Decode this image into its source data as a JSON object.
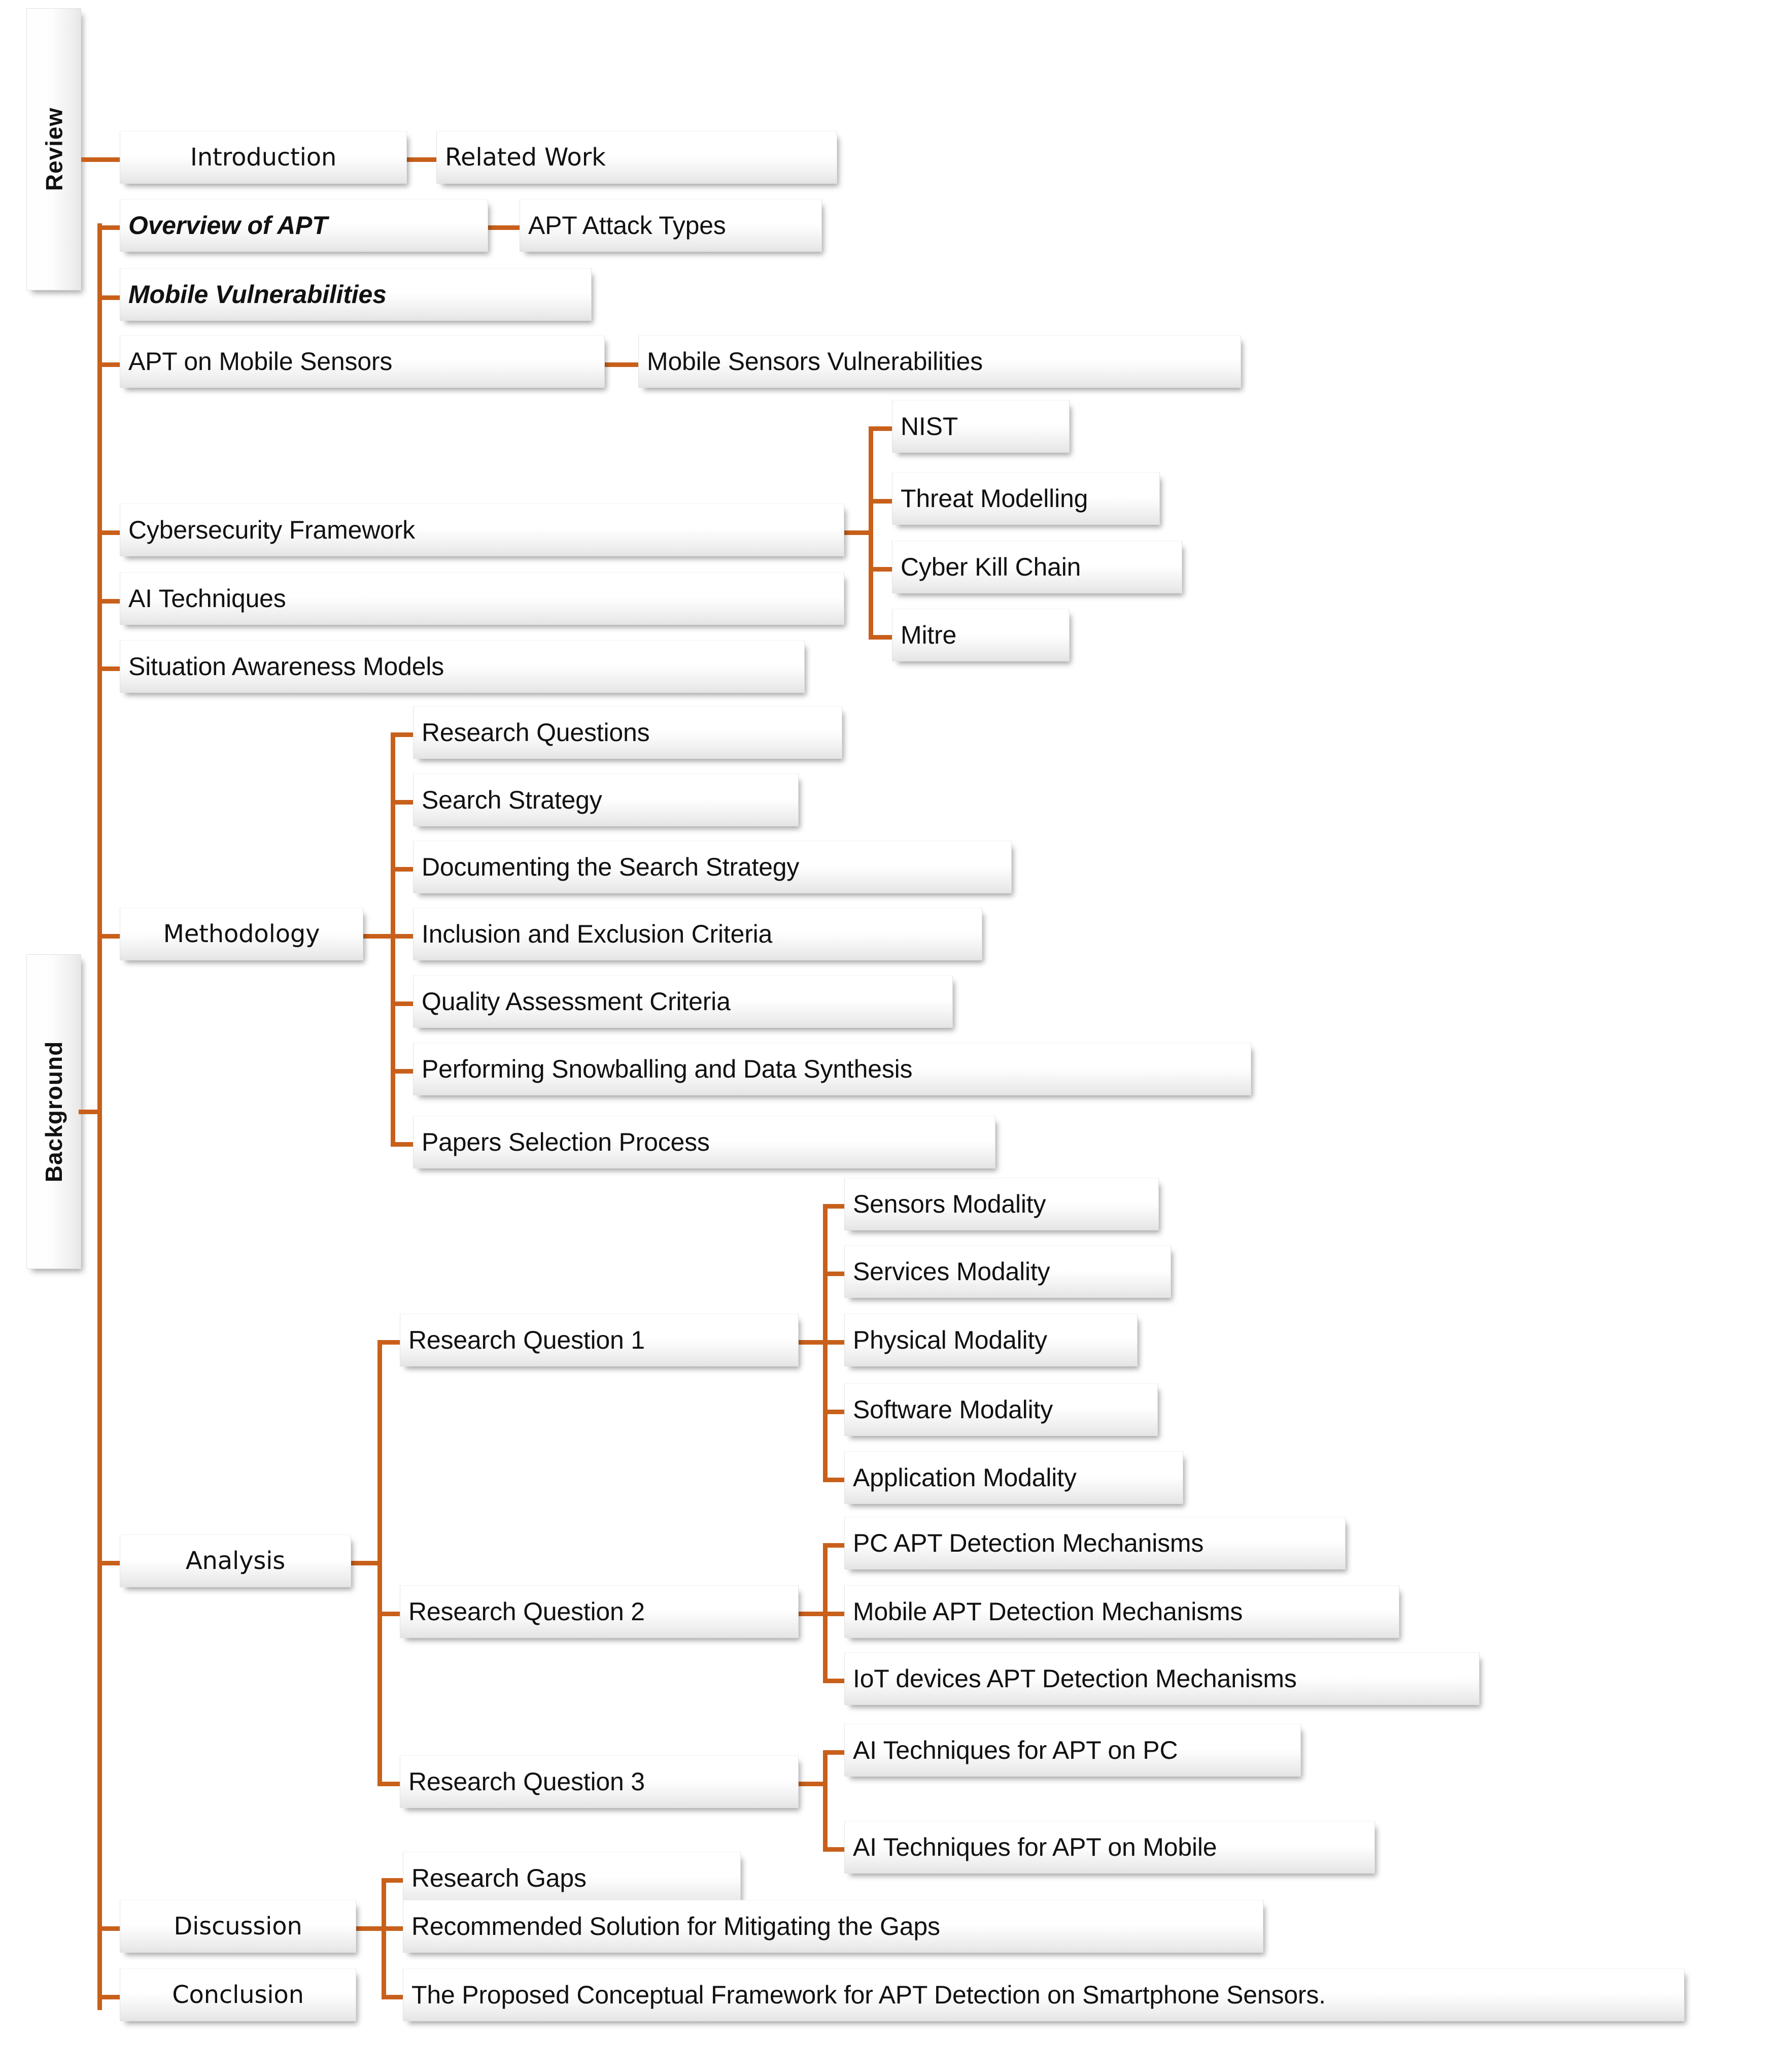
{
  "diagram": {
    "title": "APT Detection on Smartphone Sensors - Paper Structure",
    "accent_color": "#C8601B",
    "box_fill": "#f4f4f4",
    "text_color": "#111111"
  },
  "side_labels": {
    "review": "Review",
    "background": "Background"
  },
  "level1": {
    "introduction": "Introduction",
    "overview_of_apt": "Overview of APT",
    "mobile_vulnerabilities": "Mobile Vulnerabilities",
    "apt_on_mobile_sensors": "APT on Mobile Sensors",
    "cybersecurity_framework": "Cybersecurity Framework",
    "ai_techniques": "AI Techniques",
    "situation_awareness_models": "Situation Awareness Models",
    "methodology": "Methodology",
    "analysis": "Analysis",
    "discussion": "Discussion",
    "conclusion": "Conclusion"
  },
  "level2": {
    "related_work": "Related Work",
    "apt_attack_types": "APT Attack Types",
    "mobile_sensors_vulnerabilities": "Mobile Sensors Vulnerabilities",
    "framework_children": [
      "NIST",
      "Threat Modelling",
      "Cyber Kill Chain",
      "Mitre"
    ],
    "methodology_children": [
      "Research Questions",
      "Search Strategy",
      "Documenting the Search Strategy",
      "Inclusion and Exclusion Criteria",
      "Quality Assessment Criteria",
      "Performing Snowballing and Data Synthesis",
      "Papers Selection Process"
    ],
    "analysis_children": [
      "Research Question 1",
      "Research Question 2",
      "Research Question 3"
    ],
    "discussion_children": [
      "Research Gaps",
      "Recommended Solution for Mitigating the Gaps"
    ],
    "conclusion_children": [
      "The Proposed Conceptual Framework for APT Detection on Smartphone Sensors."
    ]
  },
  "level3": {
    "rq1_children": [
      "Sensors Modality",
      "Services Modality",
      "Physical Modality",
      "Software Modality",
      "Application Modality"
    ],
    "rq2_children": [
      "PC  APT Detection Mechanisms",
      "Mobile APT Detection Mechanisms",
      "IoT devices APT Detection Mechanisms"
    ],
    "rq3_children": [
      "AI Techniques for APT on PC",
      "AI Techniques for APT on Mobile"
    ]
  }
}
